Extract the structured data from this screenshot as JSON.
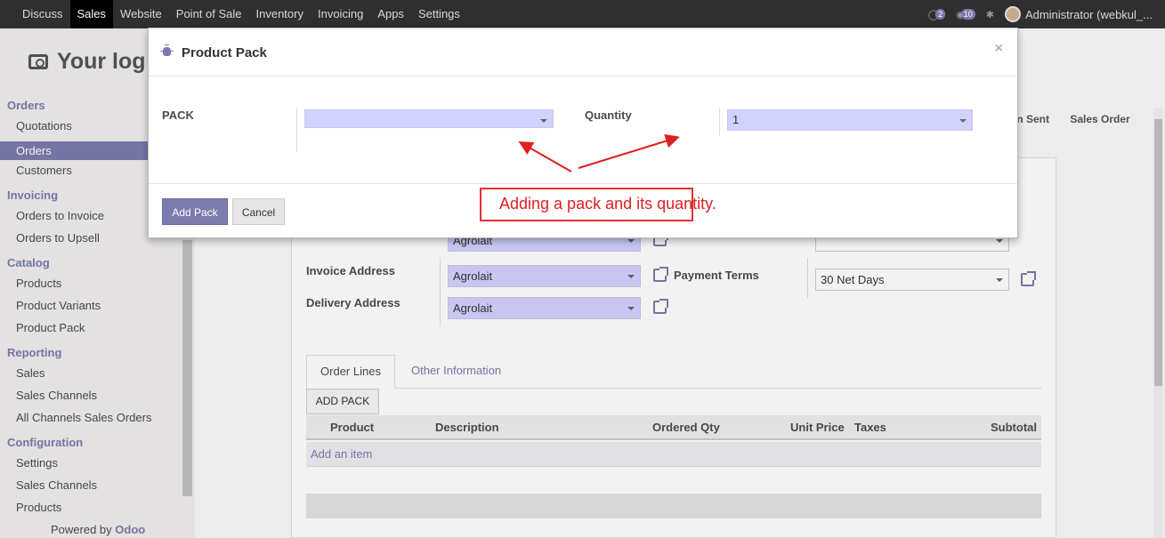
{
  "topbar": {
    "menu": [
      "Discuss",
      "Sales",
      "Website",
      "Point of Sale",
      "Inventory",
      "Invoicing",
      "Apps",
      "Settings"
    ],
    "active_menu": "Sales",
    "chat_count": "2",
    "messages_count": "10",
    "user": "Administrator (webkul_..."
  },
  "logo": {
    "text": "Your log"
  },
  "sidebar": {
    "sections": [
      {
        "title": "Orders",
        "items": [
          "Quotations",
          "Orders",
          "Customers"
        ]
      },
      {
        "title": "Invoicing",
        "items": [
          "Orders to Invoice",
          "Orders to Upsell"
        ]
      },
      {
        "title": "Catalog",
        "items": [
          "Products",
          "Product Variants",
          "Product Pack"
        ]
      },
      {
        "title": "Reporting",
        "items": [
          "Sales",
          "Sales Channels",
          "All Channels Sales Orders"
        ]
      },
      {
        "title": "Configuration",
        "items": [
          "Settings",
          "Sales Channels",
          "Products"
        ]
      }
    ],
    "active_item": "Orders",
    "powered_by": "Powered by",
    "powered_brand": "Odoo"
  },
  "breadcrumb": {
    "steps": [
      "on Sent",
      "Sales Order"
    ]
  },
  "form": {
    "customer_value": "Agrolait",
    "invoice_address_label": "Invoice Address",
    "invoice_address_value": "Agrolait",
    "delivery_address_label": "Delivery Address",
    "delivery_address_value": "Agrolait",
    "payment_terms_label": "Payment Terms",
    "payment_terms_value": "30 Net Days",
    "tabs": [
      "Order Lines",
      "Other Information"
    ],
    "add_pack_button": "ADD PACK",
    "columns": [
      "Product",
      "Description",
      "Ordered Qty",
      "Unit Price",
      "Taxes",
      "Subtotal"
    ],
    "add_item": "Add an item"
  },
  "dialog": {
    "title": "Product Pack",
    "close": "×",
    "pack_label": "PACK",
    "pack_value": "",
    "quantity_label": "Quantity",
    "quantity_value": "1",
    "add_button": "Add Pack",
    "cancel_button": "Cancel"
  },
  "annotation": {
    "text": "Adding a pack and its quantity.",
    "color": "#e02020"
  },
  "colors": {
    "accent": "#7c7bad",
    "topbar": "#2f2f2f",
    "input_bg": "#d2d2ff"
  }
}
